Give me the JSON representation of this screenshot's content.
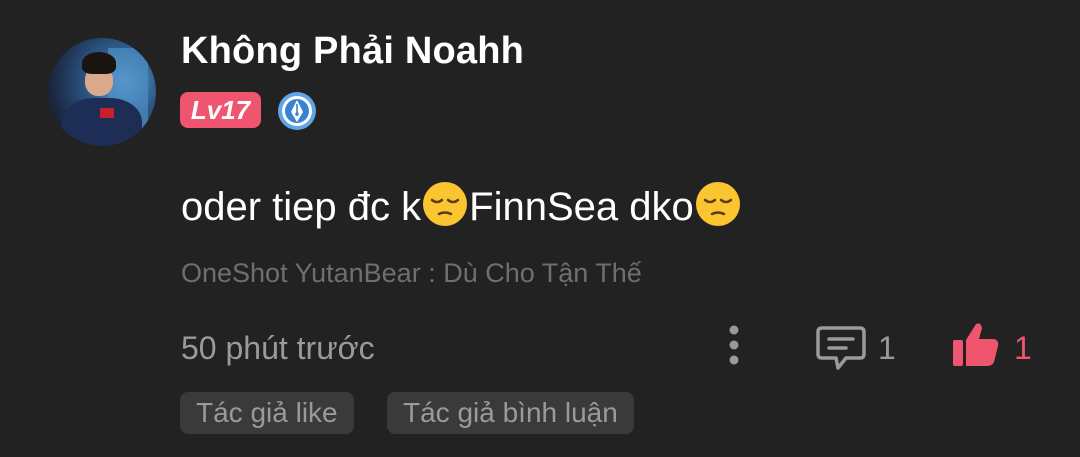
{
  "comment": {
    "username": "Không Phải Noahh",
    "level_badge": "Lv17",
    "text_part1": "oder tiep đc k",
    "text_part2": "FinnSea dko",
    "emoji_name": "pensive-face-emoji",
    "source": "OneShot YutanBear : Dù Cho Tận Thế",
    "time": "50 phút trước",
    "reply_count": "1",
    "like_count": "1",
    "tags": [
      "Tác giả like",
      "Tác giả bình luận"
    ]
  },
  "colors": {
    "background": "#222222",
    "accent": "#f0556f",
    "muted_text": "#9a9a9a",
    "tag_bg": "#3a3a3a"
  },
  "icons": {
    "more": "more-vertical-icon",
    "reply": "comment-icon",
    "like": "thumbs-up-icon",
    "badge": "pen-badge-icon"
  }
}
